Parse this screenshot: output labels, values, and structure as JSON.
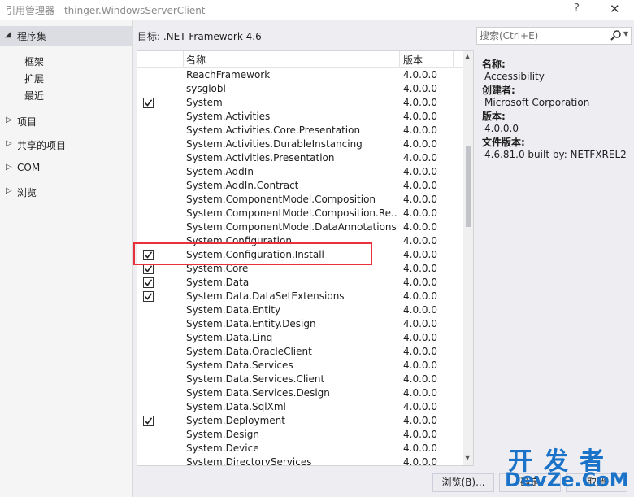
{
  "window": {
    "title": "引用管理器 - thinger.WindowsServerClient",
    "help_label": "?",
    "close_label": "✕"
  },
  "sidebar": {
    "assemblies_label": "程序集",
    "assemblies_children": [
      "框架",
      "扩展",
      "最近"
    ],
    "nodes": [
      "项目",
      "共享的项目",
      "COM",
      "浏览"
    ]
  },
  "target": "目标: .NET Framework 4.6",
  "search": {
    "placeholder": "搜索(Ctrl+E)"
  },
  "grid": {
    "columns": {
      "name": "名称",
      "version": "版本"
    },
    "rows": [
      {
        "name": "ReachFramework",
        "version": "4.0.0.0",
        "checked": false
      },
      {
        "name": "sysglobl",
        "version": "4.0.0.0",
        "checked": false
      },
      {
        "name": "System",
        "version": "4.0.0.0",
        "checked": true
      },
      {
        "name": "System.Activities",
        "version": "4.0.0.0",
        "checked": false
      },
      {
        "name": "System.Activities.Core.Presentation",
        "version": "4.0.0.0",
        "checked": false
      },
      {
        "name": "System.Activities.DurableInstancing",
        "version": "4.0.0.0",
        "checked": false
      },
      {
        "name": "System.Activities.Presentation",
        "version": "4.0.0.0",
        "checked": false
      },
      {
        "name": "System.AddIn",
        "version": "4.0.0.0",
        "checked": false
      },
      {
        "name": "System.AddIn.Contract",
        "version": "4.0.0.0",
        "checked": false
      },
      {
        "name": "System.ComponentModel.Composition",
        "version": "4.0.0.0",
        "checked": false
      },
      {
        "name": "System.ComponentModel.Composition.Re...",
        "version": "4.0.0.0",
        "checked": false
      },
      {
        "name": "System.ComponentModel.DataAnnotations",
        "version": "4.0.0.0",
        "checked": false
      },
      {
        "name": "System.Configuration",
        "version": "4.0.0.0",
        "checked": false
      },
      {
        "name": "System.Configuration.Install",
        "version": "4.0.0.0",
        "checked": true
      },
      {
        "name": "System.Core",
        "version": "4.0.0.0",
        "checked": true
      },
      {
        "name": "System.Data",
        "version": "4.0.0.0",
        "checked": true
      },
      {
        "name": "System.Data.DataSetExtensions",
        "version": "4.0.0.0",
        "checked": true
      },
      {
        "name": "System.Data.Entity",
        "version": "4.0.0.0",
        "checked": false
      },
      {
        "name": "System.Data.Entity.Design",
        "version": "4.0.0.0",
        "checked": false
      },
      {
        "name": "System.Data.Linq",
        "version": "4.0.0.0",
        "checked": false
      },
      {
        "name": "System.Data.OracleClient",
        "version": "4.0.0.0",
        "checked": false
      },
      {
        "name": "System.Data.Services",
        "version": "4.0.0.0",
        "checked": false
      },
      {
        "name": "System.Data.Services.Client",
        "version": "4.0.0.0",
        "checked": false
      },
      {
        "name": "System.Data.Services.Design",
        "version": "4.0.0.0",
        "checked": false
      },
      {
        "name": "System.Data.SqlXml",
        "version": "4.0.0.0",
        "checked": false
      },
      {
        "name": "System.Deployment",
        "version": "4.0.0.0",
        "checked": true
      },
      {
        "name": "System.Design",
        "version": "4.0.0.0",
        "checked": false
      },
      {
        "name": "System.Device",
        "version": "4.0.0.0",
        "checked": false
      },
      {
        "name": "System.DirectoryServices",
        "version": "4.0.0.0",
        "checked": false
      }
    ]
  },
  "details": {
    "name_label": "名称:",
    "name_value": "Accessibility",
    "creator_label": "创建者:",
    "creator_value": "Microsoft Corporation",
    "version_label": "版本:",
    "version_value": "4.0.0.0",
    "file_version_label": "文件版本:",
    "file_version_value": "4.6.81.0 built by: NETFXREL2"
  },
  "buttons": {
    "browse": "浏览(B)...",
    "ok": "确定",
    "cancel": "取消"
  },
  "watermark": {
    "cn": "开发者",
    "en": "DevZe.CoM"
  },
  "colors": {
    "highlight": "#e8313a",
    "selected_group": "#dcdde3",
    "watermark": "#1a73c8"
  }
}
